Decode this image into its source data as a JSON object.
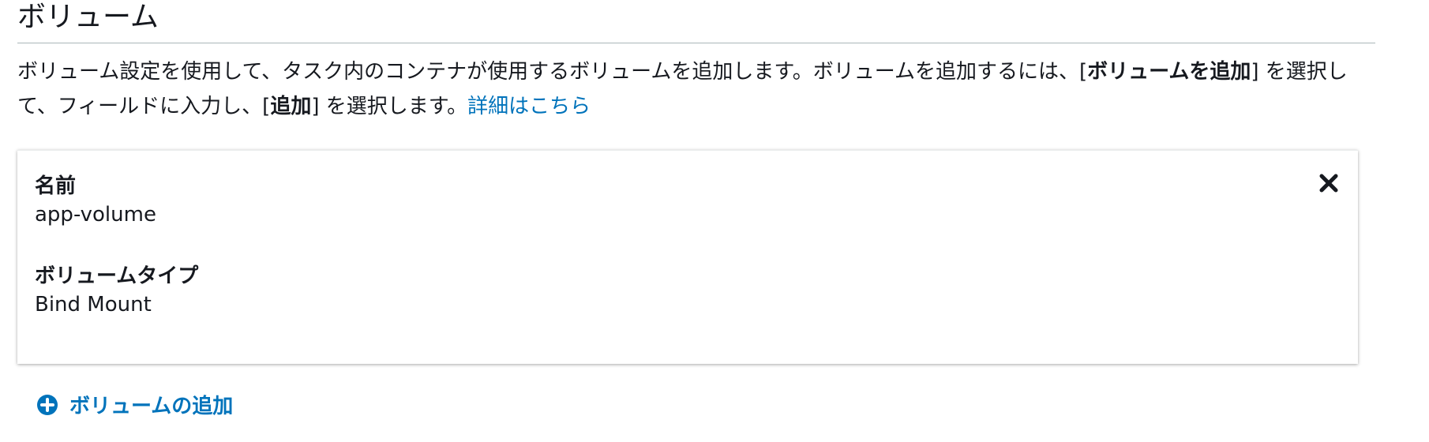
{
  "section": {
    "title": "ボリューム",
    "desc_part1": "ボリューム設定を使用して、タスク内のコンテナが使用するボリュームを追加します。ボリュームを追加するには、[",
    "desc_bold1": "ボリュームを追加",
    "desc_part2": "] を選択して、フィールドに入力し、[",
    "desc_bold2": "追加",
    "desc_part3": "] を選択します。",
    "learn_more": "詳細はこちら"
  },
  "volume": {
    "name_label": "名前",
    "name_value": "app-volume",
    "type_label": "ボリュームタイプ",
    "type_value": "Bind Mount"
  },
  "add_volume_label": "ボリュームの追加",
  "colors": {
    "link": "#0073bb",
    "text": "#16191f",
    "divider": "#aab7b8"
  },
  "icons": {
    "close": "close-icon",
    "add": "plus-circle-icon"
  }
}
